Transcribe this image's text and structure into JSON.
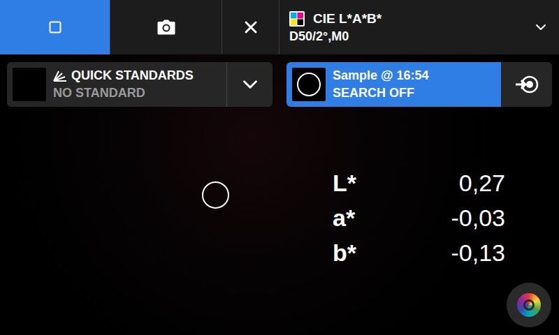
{
  "toolbar": {
    "tabs": [
      {
        "kind": "view",
        "selected": true
      },
      {
        "kind": "camera",
        "selected": false
      },
      {
        "kind": "close",
        "selected": false
      }
    ]
  },
  "color_space": {
    "title": "CIE L*A*B*",
    "conditions": "D50/2°,M0"
  },
  "standard": {
    "title": "QUICK STANDARDS",
    "value": "NO STANDARD"
  },
  "sample": {
    "title": "Sample @ 16:54",
    "search": "SEARCH OFF"
  },
  "readings": [
    {
      "label": "L*",
      "value": "0,27"
    },
    {
      "label": "a*",
      "value": "-0,03"
    },
    {
      "label": "b*",
      "value": "-0,13"
    }
  ]
}
